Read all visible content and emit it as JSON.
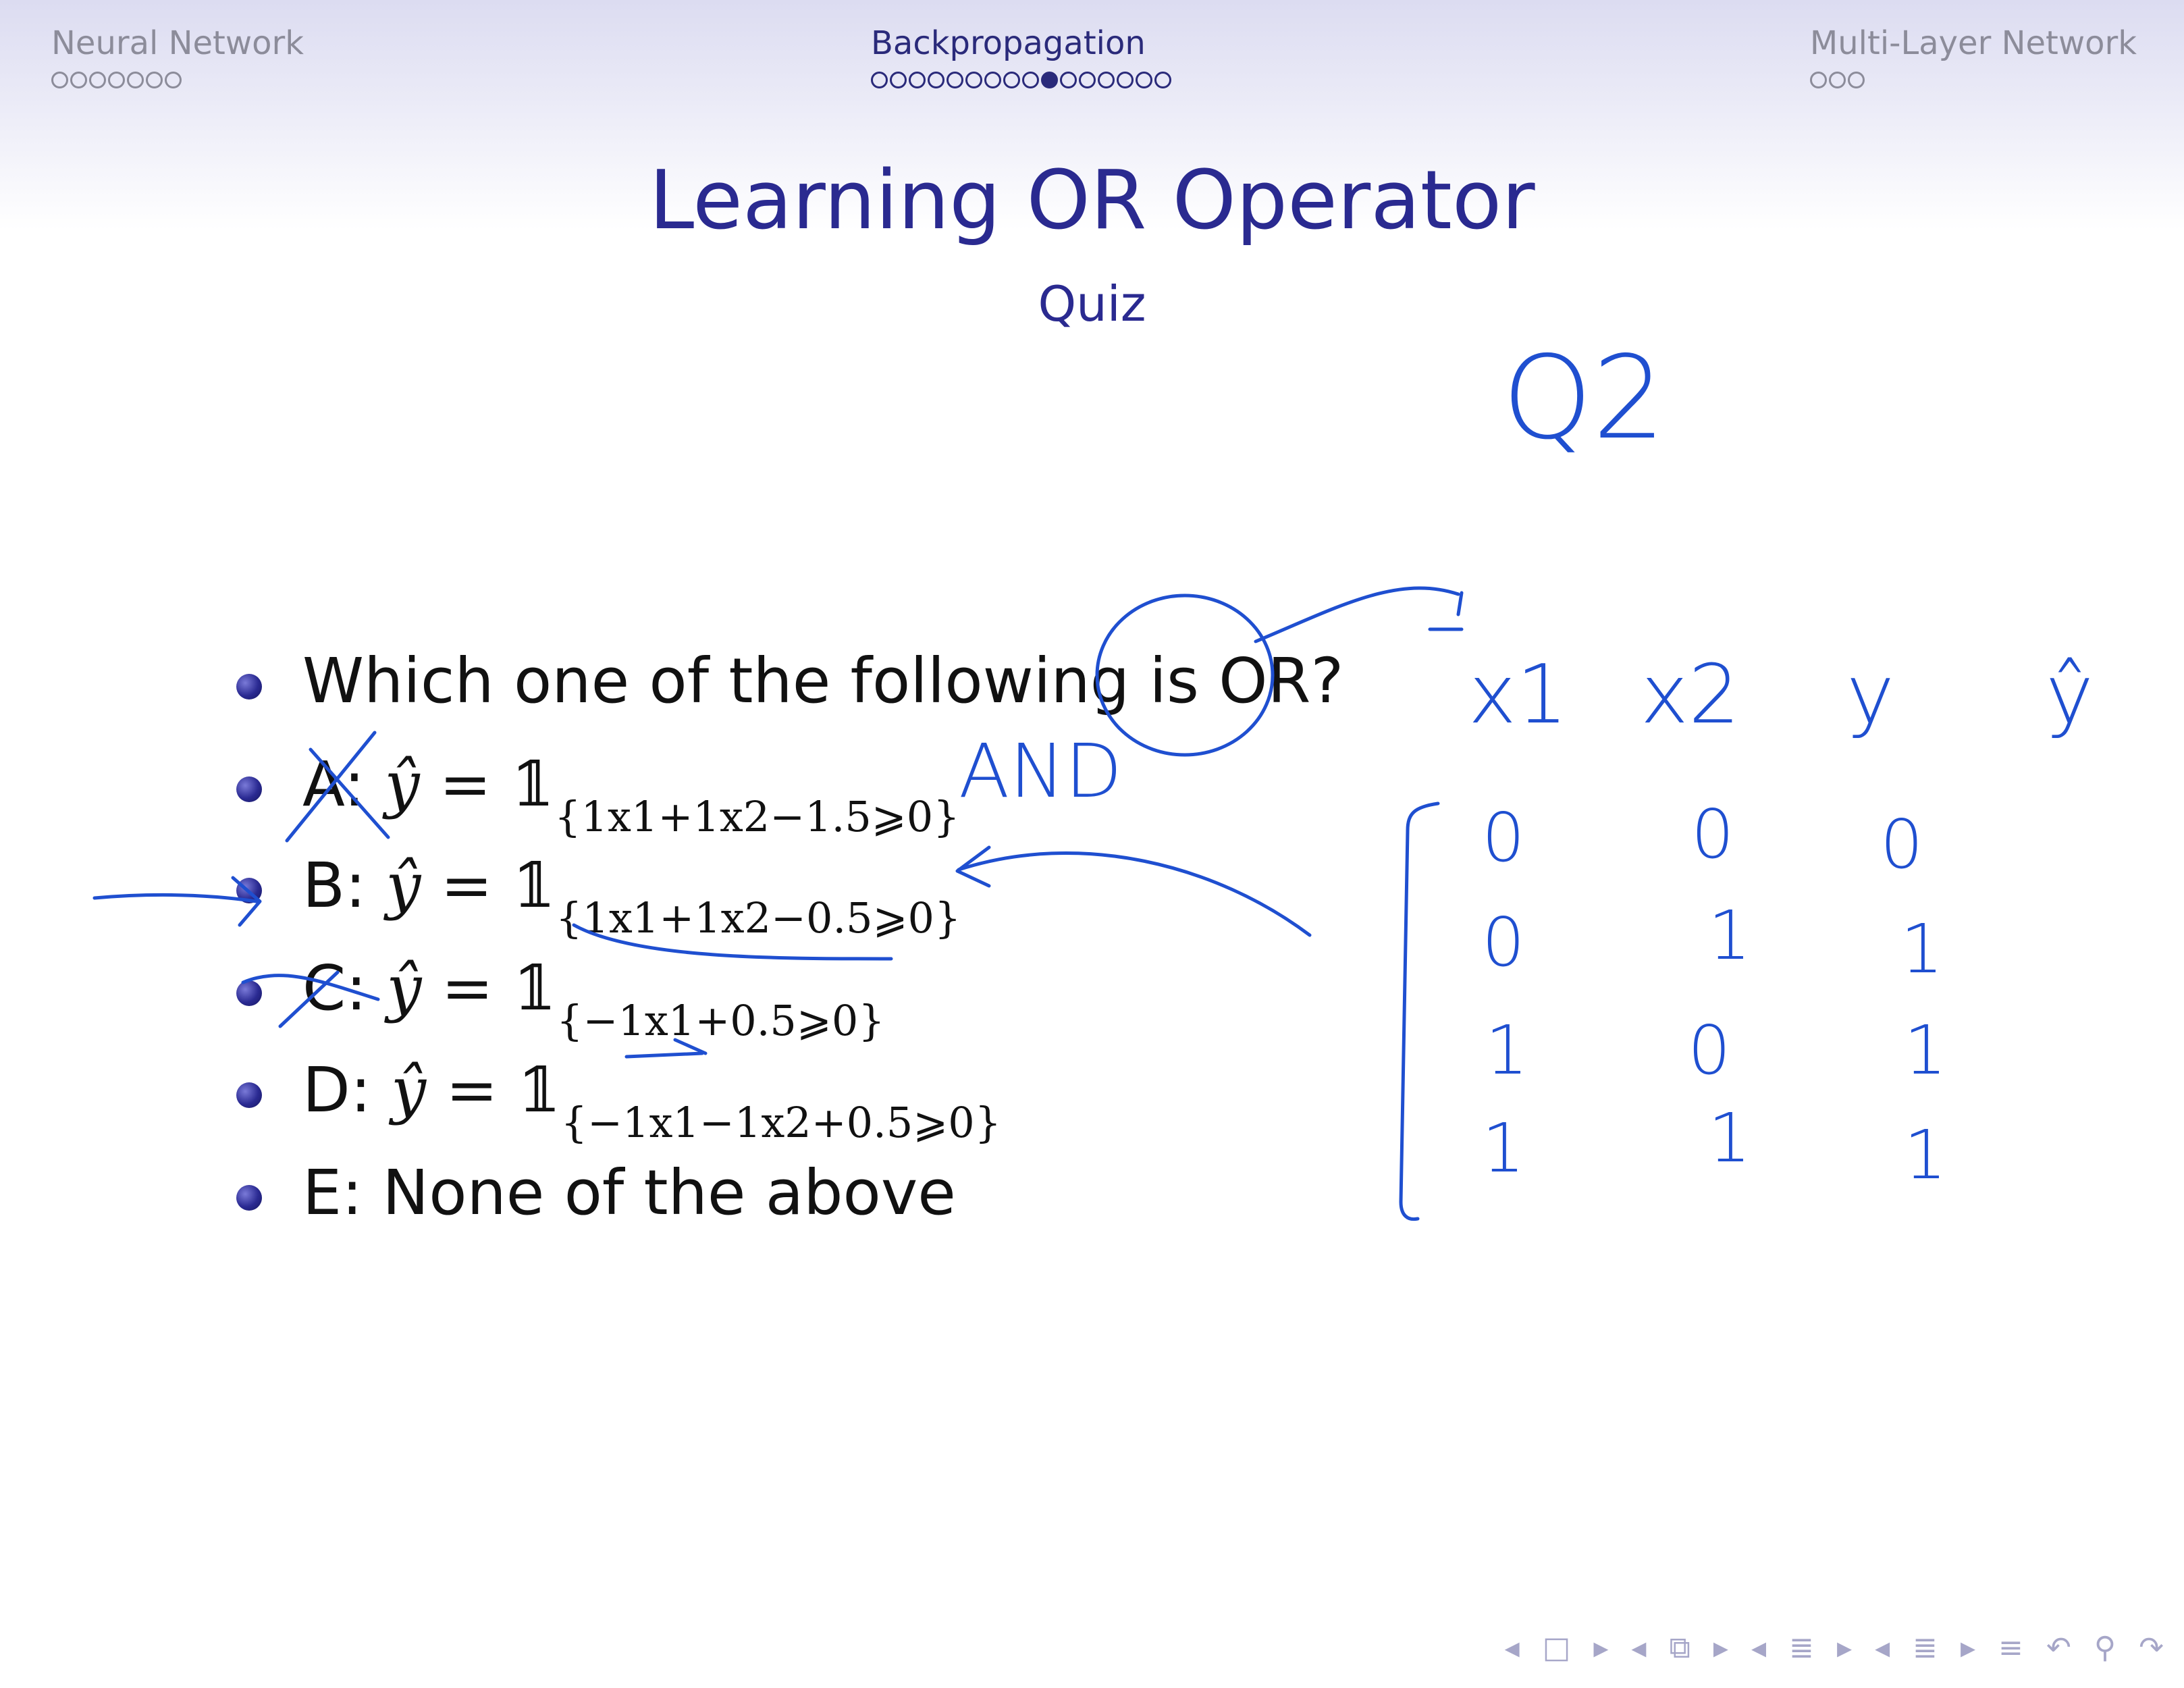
{
  "header": {
    "sections": [
      {
        "name": "Neural Network",
        "dots": 7,
        "current": -1
      },
      {
        "name": "Backpropagation",
        "dots": 16,
        "current": 9
      },
      {
        "name": "Multi-Layer Network",
        "dots": 3,
        "current": -1
      }
    ]
  },
  "slide": {
    "title": "Learning OR Operator",
    "subtitle": "Quiz",
    "question": "Which one of the following is OR?",
    "options": [
      {
        "label": "A: ",
        "expr": "{1x1+1x2−1.5⩾0}"
      },
      {
        "label": "B: ",
        "expr": "{1x1+1x2−0.5⩾0}"
      },
      {
        "label": "C: ",
        "expr": "{−1x1+0.5⩾0}"
      },
      {
        "label": "D: ",
        "expr": "{−1x1−1x2+0.5⩾0}"
      },
      {
        "label": "E: None of the above"
      }
    ]
  },
  "annotations": {
    "q_label": "Q2",
    "and_note": "AND",
    "table_header": [
      "x1",
      "x2",
      "y",
      "ŷ"
    ],
    "table_rows": [
      [
        "0",
        "0",
        "0"
      ],
      [
        "0",
        "1",
        "1"
      ],
      [
        "1",
        "0",
        "1"
      ],
      [
        "1",
        "1",
        "1"
      ]
    ]
  },
  "nav_icons": [
    "prev-frame-icon",
    "frame-icon",
    "next-frame-icon",
    "prev-subsection-icon",
    "subsection-icon",
    "next-subsection-icon",
    "prev-section-icon",
    "section-icon",
    "next-section-icon",
    "prev-slide-icon",
    "slide-icon",
    "next-slide-icon",
    "toc-icon",
    "back-icon",
    "search-icon",
    "forward-icon"
  ],
  "colors": {
    "theme": "#2a2a90",
    "ink": "#1f4fd0",
    "header_inactive": "#8c8c9a"
  }
}
